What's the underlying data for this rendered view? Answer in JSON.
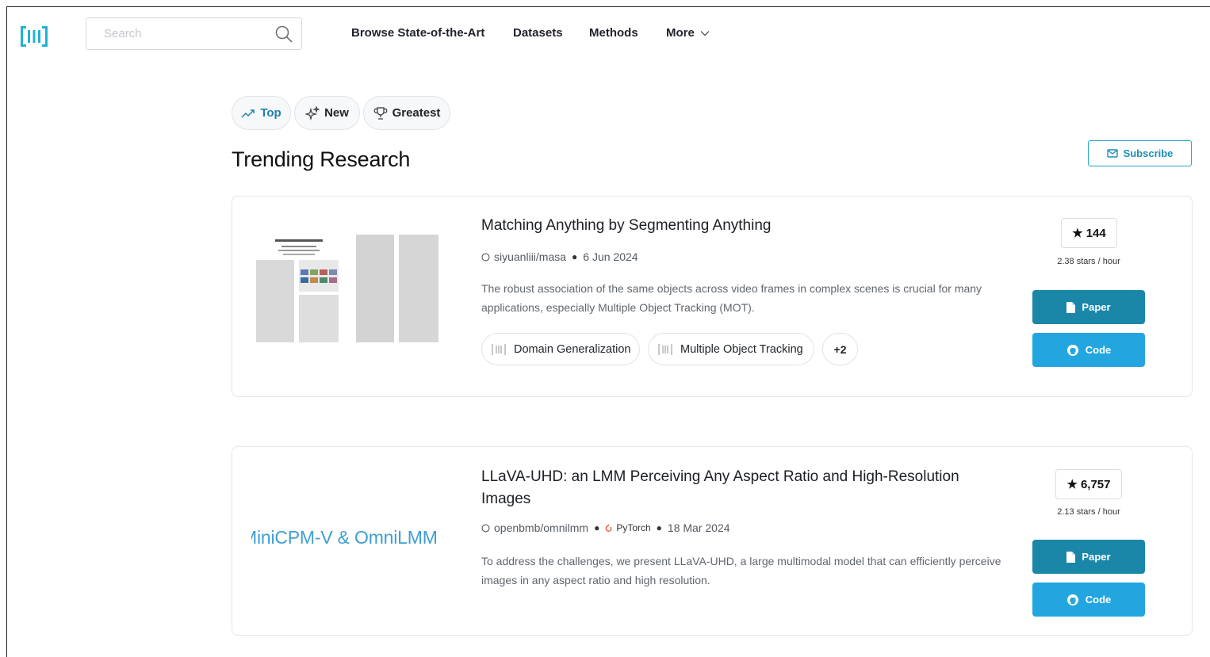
{
  "nav": {
    "search_placeholder": "Search",
    "links": [
      "Browse State-of-the-Art",
      "Datasets",
      "Methods",
      "More"
    ]
  },
  "tabs": [
    "Top",
    "New",
    "Greatest"
  ],
  "page_title": "Trending Research",
  "subscribe_label": "Subscribe",
  "papers": [
    {
      "title": "Matching Anything by Segmenting Anything",
      "repo": "siyuanliii/masa",
      "framework": "",
      "date": "6 Jun 2024",
      "abstract": "The robust association of the same objects across video frames in complex scenes is crucial for many applications, especially Multiple Object Tracking (MOT).",
      "tags": [
        "Domain Generalization",
        "Multiple Object Tracking"
      ],
      "more_tags": "+2",
      "stars": "144",
      "stars_rate": "2.38 stars / hour",
      "paper_label": "Paper",
      "code_label": "Code"
    },
    {
      "title": "LLaVA-UHD: an LMM Perceiving Any Aspect Ratio and High-Resolution Images",
      "repo": "openbmb/omnilmm",
      "framework": "PyTorch",
      "date": "18 Mar 2024",
      "abstract": "To address the challenges, we present LLaVA-UHD, a large multimodal model that can efficiently perceive images in any aspect ratio and high resolution.",
      "thumb_text": "MiniCPM-V & OmniLMM",
      "stars": "6,757",
      "stars_rate": "2.13 stars / hour",
      "paper_label": "Paper",
      "code_label": "Code"
    }
  ],
  "colors": {
    "accent": "#21a7c8",
    "paper_button": "#1a87a8",
    "code_button": "#23a6e0",
    "logo": "#21b2d1"
  }
}
